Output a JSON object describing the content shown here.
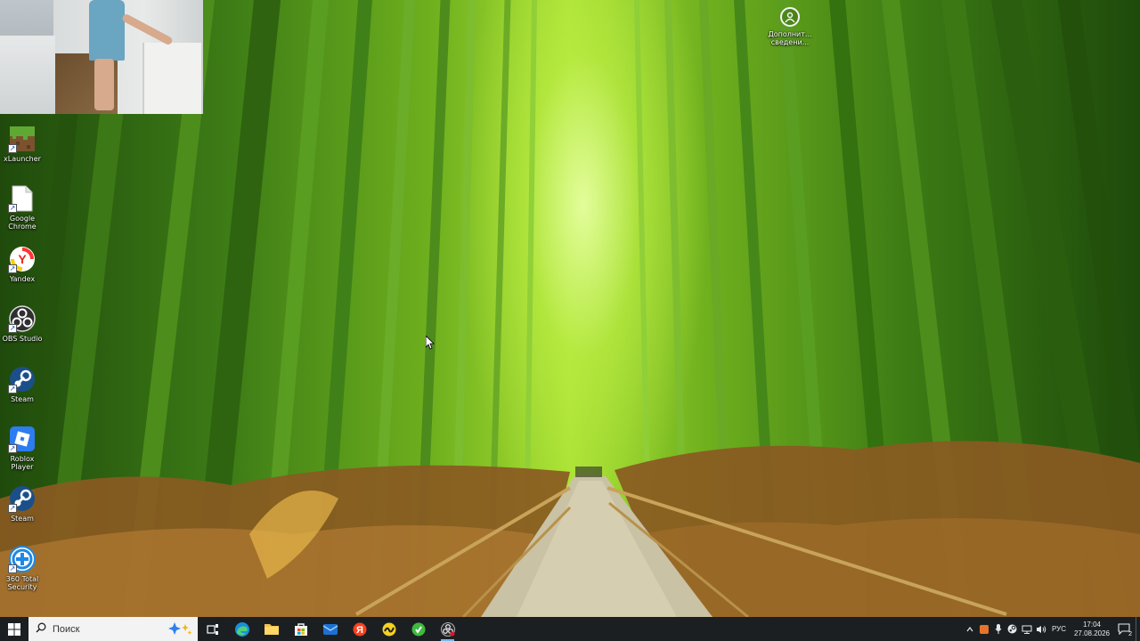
{
  "desktop": {
    "wallpaper": "bamboo-forest-path",
    "icons": [
      {
        "label": "xLauncher",
        "icon": "minecraft-grass-block-icon"
      },
      {
        "label": "Google Chrome",
        "icon": "blank-file-icon"
      },
      {
        "label": "Yandex",
        "icon": "yandex-browser-icon"
      },
      {
        "label": "OBS Studio",
        "icon": "obs-studio-icon"
      },
      {
        "label": "Steam",
        "icon": "steam-icon"
      },
      {
        "label": "Roblox Player",
        "icon": "roblox-icon"
      },
      {
        "label": "Steam",
        "icon": "steam-icon"
      },
      {
        "label": "360 Total Security",
        "icon": "360-total-security-icon"
      }
    ],
    "extra_icon": {
      "label": "Дополнит...\nсведени...",
      "icon": "info-circle-icon"
    }
  },
  "taskbar": {
    "search": {
      "placeholder": "Поиск"
    },
    "apps": [
      "task-view-icon",
      "edge-icon",
      "file-explorer-icon",
      "microsoft-store-icon",
      "mail-icon",
      "yandex-icon",
      "bolt-app-icon",
      "green-app-icon",
      "obs-studio-icon"
    ],
    "tray": {
      "language": "РУС",
      "time": "17:04",
      "date": "27.08.2026",
      "notifications": "2"
    }
  },
  "colors": {
    "taskbar": "#1c1f22",
    "accent": "#76b9ed"
  }
}
